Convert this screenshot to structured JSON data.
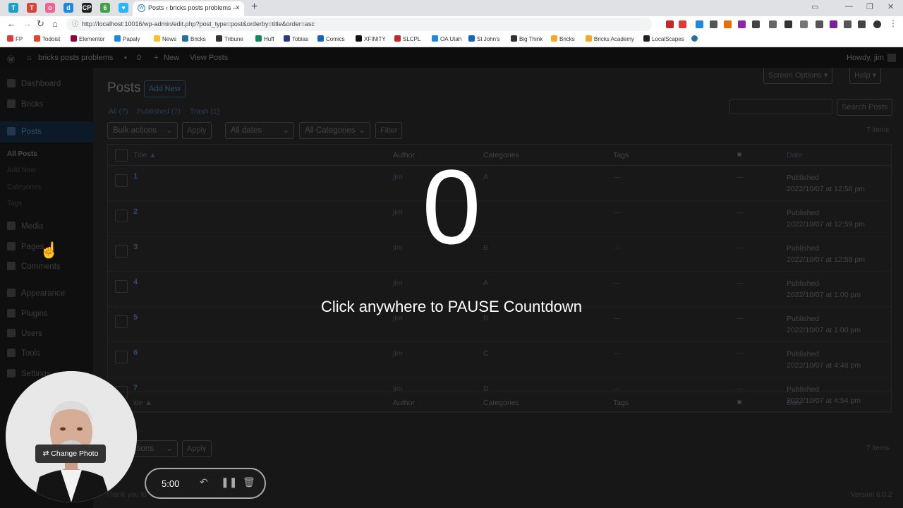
{
  "browser": {
    "pinned_tabs": [
      {
        "icon": "todoist-icon",
        "color": "#1da0c3",
        "label": "T"
      },
      {
        "icon": "tribune-icon",
        "color": "#d44638",
        "label": "T"
      },
      {
        "icon": "circle-icon",
        "color": "#f06292",
        "label": "o"
      },
      {
        "icon": "doc-icon",
        "color": "#1e88e5",
        "label": "d"
      },
      {
        "icon": "cp-icon",
        "color": "#222222",
        "label": "CP"
      },
      {
        "icon": "leaf-icon",
        "color": "#43a047",
        "label": "6"
      },
      {
        "icon": "heart-icon",
        "color": "#29b6f6",
        "label": "♥"
      }
    ],
    "active_tab_title": "Posts ‹ bricks posts problems —",
    "url": "http://localhost:10016/wp-admin/edit.php?post_type=post&orderby=title&order=asc",
    "bookmarks": [
      {
        "label": "FP",
        "color": "#e53935"
      },
      {
        "label": "Todoist",
        "color": "#e44332"
      },
      {
        "label": "Elementor",
        "color": "#92003b"
      },
      {
        "label": "Papaly",
        "color": "#1e88e5"
      },
      {
        "label": "News",
        "color": "#fbc02d"
      },
      {
        "label": "Bricks",
        "color": "#21759b"
      },
      {
        "label": "Tribune",
        "color": "#333333"
      },
      {
        "label": "Huff",
        "color": "#0d8a5f"
      },
      {
        "label": "Tobias",
        "color": "#2a3a8c"
      },
      {
        "label": "Comics",
        "color": "#1565c0"
      },
      {
        "label": "XFINITY",
        "color": "#111111"
      },
      {
        "label": "SLCPL",
        "color": "#c62828"
      },
      {
        "label": "OA Utah",
        "color": "#1e88e5"
      },
      {
        "label": "St John's",
        "color": "#1565c0"
      },
      {
        "label": "Big Think",
        "color": "#333333"
      },
      {
        "label": "Bricks",
        "color": "#f9a825"
      },
      {
        "label": "Bricks Academy",
        "color": "#f9a825"
      },
      {
        "label": "LocalScapes",
        "color": "#222222"
      }
    ]
  },
  "adminbar": {
    "site_name": "bricks posts problems",
    "comments": "0",
    "new": "New",
    "view": "View Posts",
    "howdy": "Howdy, jim"
  },
  "menu": {
    "dashboard": "Dashboard",
    "bricks": "Bricks",
    "posts": "Posts",
    "all_posts": "All Posts",
    "add_new": "Add New",
    "categories": "Categories",
    "tags": "Tags",
    "media": "Media",
    "pages": "Pages",
    "comments": "Comments",
    "appearance": "Appearance",
    "plugins": "Plugins",
    "users": "Users",
    "tools": "Tools",
    "settings": "Settings"
  },
  "page": {
    "title": "Posts",
    "add_new": "Add New",
    "screen_options": "Screen Options ▾",
    "help": "Help ▾",
    "filters": {
      "all": "All (7)",
      "published": "Published (7)",
      "trash": "Trash (1)"
    },
    "search_button": "Search Posts",
    "bulk_actions": "Bulk actions",
    "apply": "Apply",
    "all_dates": "All dates",
    "all_categories": "All Categories",
    "filter": "Filter",
    "items_count": "7 items",
    "bottom_bulk": "ctions",
    "footer_left": "Thank you fo",
    "version": "Version 6.0.2"
  },
  "table": {
    "col_title": "Title ▲",
    "col_title_bottom": "itle ▲",
    "col_author": "Author",
    "col_categories": "Categories",
    "col_tags": "Tags",
    "col_date": "Date",
    "rows": [
      {
        "title": "1",
        "author": "jim",
        "category": "A",
        "tags": "—",
        "comments": "—",
        "status": "Published",
        "date": "2022/10/07 at 12:58 pm"
      },
      {
        "title": "2",
        "author": "jim",
        "category": "",
        "tags": "—",
        "comments": "—",
        "status": "Published",
        "date": "2022/10/07 at 12:59 pm"
      },
      {
        "title": "3",
        "author": "jim",
        "category": "B",
        "tags": "—",
        "comments": "—",
        "status": "Published",
        "date": "2022/10/07 at 12:59 pm"
      },
      {
        "title": "4",
        "author": "jim",
        "category": "A",
        "tags": "—",
        "comments": "—",
        "status": "Published",
        "date": "2022/10/07 at 1:00 pm"
      },
      {
        "title": "5",
        "author": "jim",
        "category": "B",
        "tags": "—",
        "comments": "—",
        "status": "Published",
        "date": "2022/10/07 at 1:00 pm"
      },
      {
        "title": "6",
        "author": "jim",
        "category": "C",
        "tags": "—",
        "comments": "—",
        "status": "Published",
        "date": "2022/10/07 at 4:48 pm"
      },
      {
        "title": "7",
        "author": "jim",
        "category": "D",
        "tags": "—",
        "comments": "—",
        "status": "Published",
        "date": "2022/10/07 at 4:54 pm"
      }
    ]
  },
  "overlay": {
    "countdown": "0",
    "message": "Click anywhere to PAUSE Countdown",
    "change_photo": "Change Photo",
    "timer": "5:00"
  }
}
